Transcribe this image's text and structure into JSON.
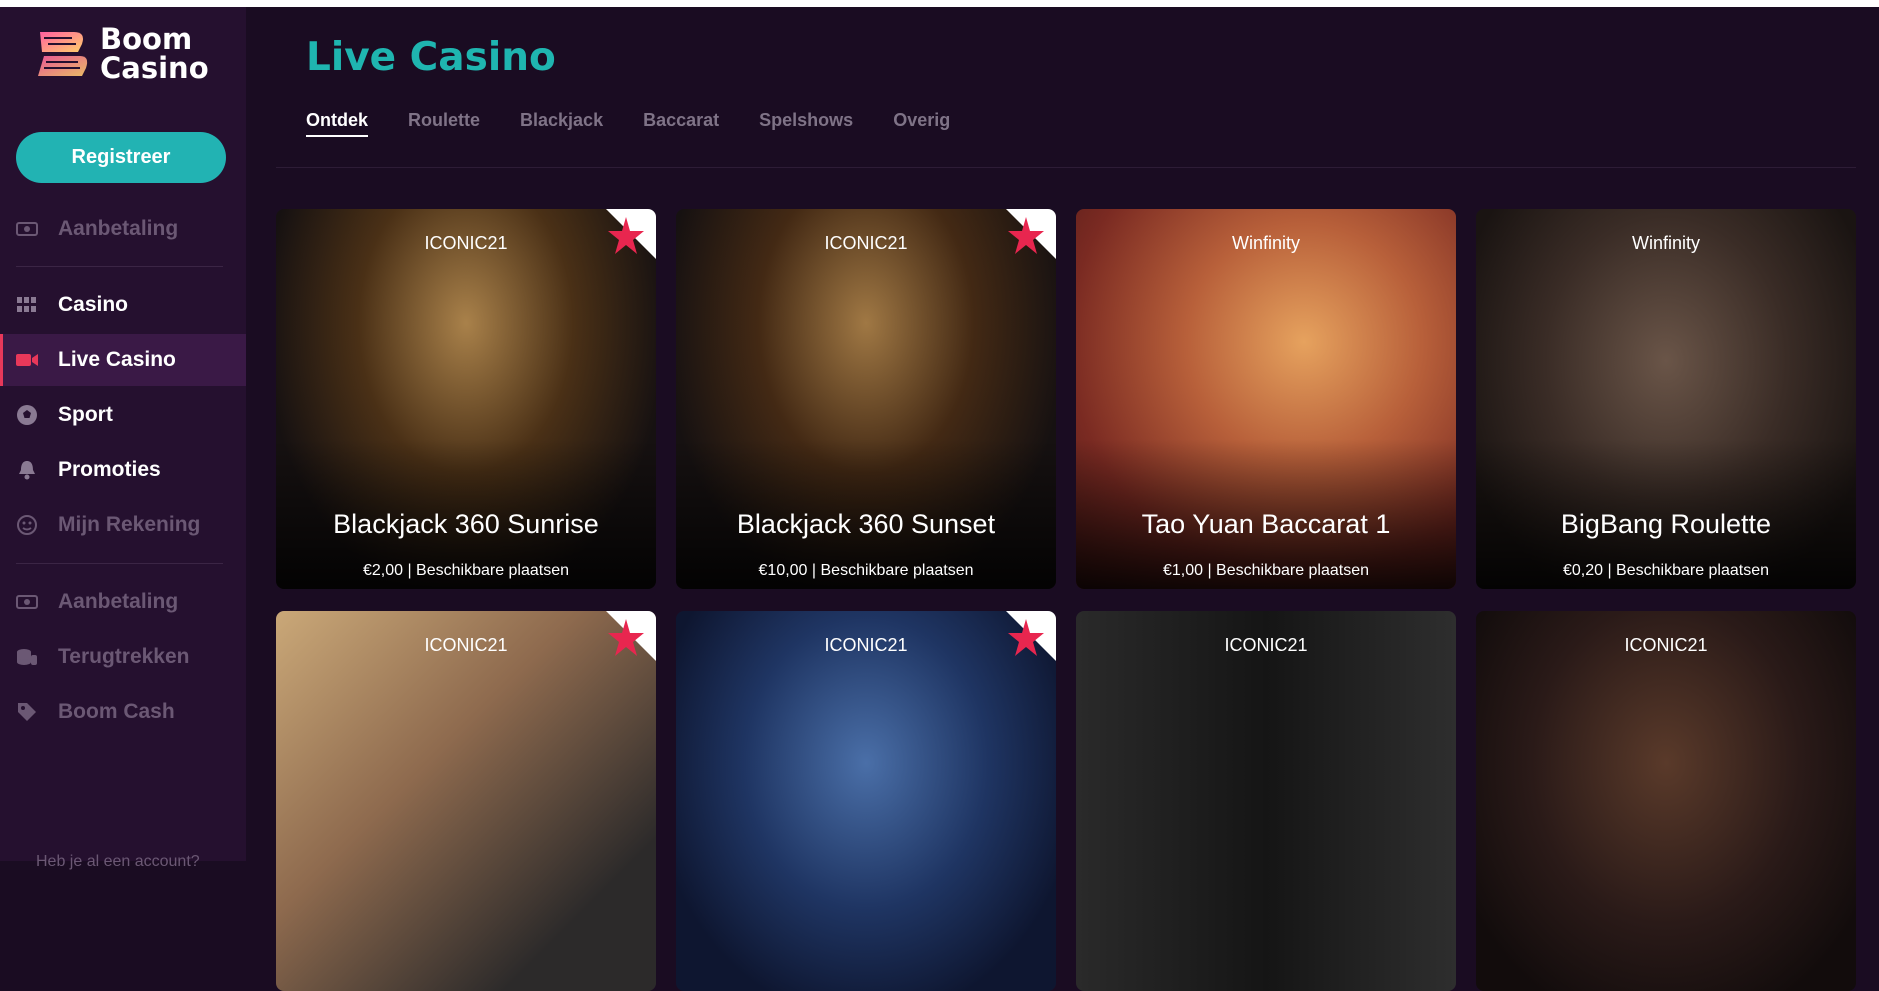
{
  "brand": {
    "line1": "Boom",
    "line2": "Casino"
  },
  "sidebar": {
    "register_label": "Registreer",
    "items": [
      {
        "label": "Aanbetaling",
        "icon": "cash-icon"
      },
      {
        "label": "Casino",
        "icon": "grid-icon"
      },
      {
        "label": "Live Casino",
        "icon": "camera-icon"
      },
      {
        "label": "Sport",
        "icon": "soccer-ball-icon"
      },
      {
        "label": "Promoties",
        "icon": "bell-icon"
      },
      {
        "label": "Mijn Rekening",
        "icon": "user-face-icon"
      },
      {
        "label": "Aanbetaling",
        "icon": "cash-icon"
      },
      {
        "label": "Terugtrekken",
        "icon": "coins-icon"
      },
      {
        "label": "Boom Cash",
        "icon": "tag-icon"
      }
    ],
    "account_hint": "Heb je al een account?"
  },
  "main": {
    "title": "Live Casino",
    "tabs": [
      {
        "label": "Ontdek"
      },
      {
        "label": "Roulette"
      },
      {
        "label": "Blackjack"
      },
      {
        "label": "Baccarat"
      },
      {
        "label": "Spelshows"
      },
      {
        "label": "Overig"
      }
    ]
  },
  "games": [
    {
      "provider": "ICONIC21",
      "name": "Blackjack 360 Sunrise",
      "meta": "€2,00  |  Beschikbare plaatsen",
      "featured": true
    },
    {
      "provider": "ICONIC21",
      "name": "Blackjack 360 Sunset",
      "meta": "€10,00  |  Beschikbare plaatsen",
      "featured": true
    },
    {
      "provider": "Winfinity",
      "name": "Tao Yuan Baccarat 1",
      "meta": "€1,00  |  Beschikbare plaatsen",
      "featured": false
    },
    {
      "provider": "Winfinity",
      "name": "BigBang Roulette",
      "meta": "€0,20  |  Beschikbare plaatsen",
      "featured": false
    },
    {
      "provider": "ICONIC21",
      "name": "",
      "meta": "",
      "featured": true
    },
    {
      "provider": "ICONIC21",
      "name": "",
      "meta": "",
      "featured": true
    },
    {
      "provider": "ICONIC21",
      "name": "",
      "meta": "",
      "featured": false
    },
    {
      "provider": "ICONIC21",
      "name": "",
      "meta": "",
      "featured": false
    }
  ],
  "colors": {
    "accent": "#1fb5b0",
    "active_marker": "#e8385a",
    "badge_star": "#e8264f"
  }
}
